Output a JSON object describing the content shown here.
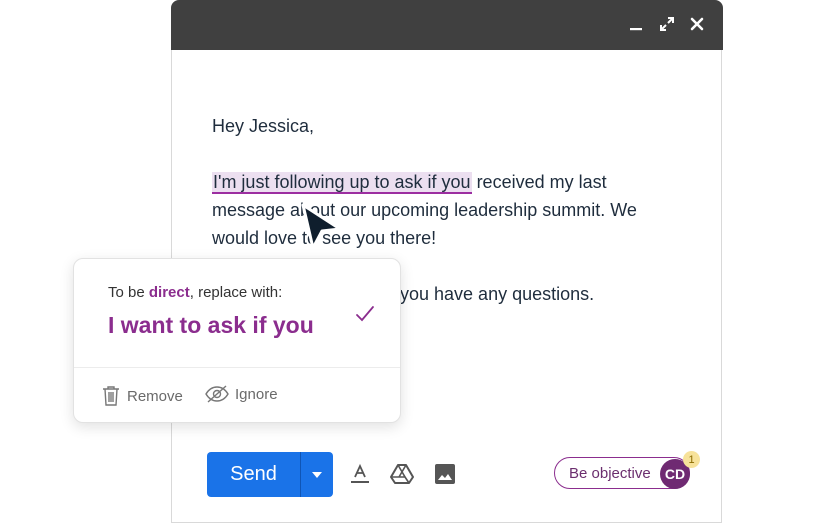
{
  "window": {
    "minimize_icon": "minimize-icon",
    "expand_icon": "expand-icon",
    "close_icon": "close-icon"
  },
  "email": {
    "greeting": "Hey Jessica,",
    "highlighted_phrase": "I'm just following up to ask if you",
    "sentence_rest": " received my last message about our upcoming leadership summit. We would love to see you there!",
    "line3_visible": "you have any questions."
  },
  "suggestion": {
    "prefix": "To be ",
    "tone_word": "direct",
    "suffix": ", replace with:",
    "replacement": "I want to ask if you",
    "remove_label": "Remove",
    "ignore_label": "Ignore"
  },
  "toolbar": {
    "send_label": "Send",
    "tone_pill_label": "Be objective",
    "avatar_initials": "CD",
    "notification_count": "1"
  },
  "colors": {
    "accent": "#8b2d8e",
    "send": "#1a73e8",
    "titlebar": "#404040"
  }
}
